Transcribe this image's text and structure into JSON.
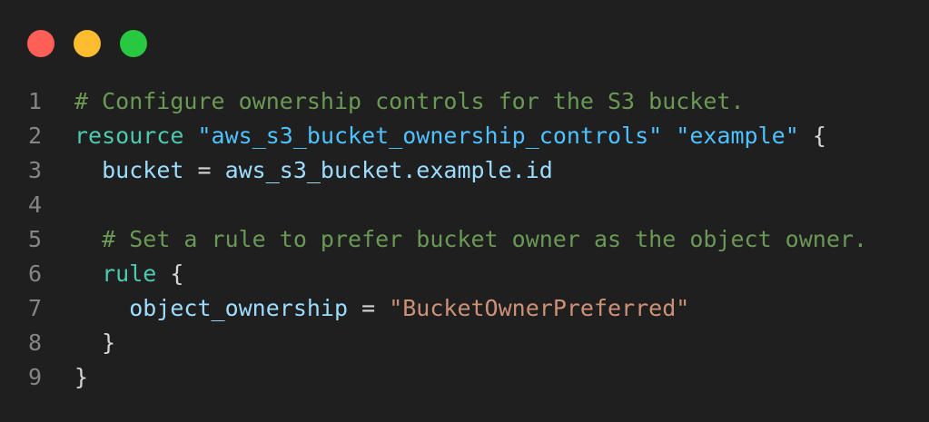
{
  "window": {
    "controls": [
      {
        "name": "close",
        "color": "#ff5f57"
      },
      {
        "name": "minimize",
        "color": "#febc2e"
      },
      {
        "name": "maximize",
        "color": "#28c840"
      }
    ]
  },
  "editor": {
    "language": "HCL",
    "lines": [
      {
        "number": "1",
        "tokens": [
          {
            "type": "comment",
            "text": "# Configure ownership controls for the S3 bucket."
          }
        ]
      },
      {
        "number": "2",
        "tokens": [
          {
            "type": "keyword",
            "text": "resource"
          },
          {
            "type": "punct",
            "text": " "
          },
          {
            "type": "string",
            "text": "\"aws_s3_bucket_ownership_controls\""
          },
          {
            "type": "punct",
            "text": " "
          },
          {
            "type": "string",
            "text": "\"example\""
          },
          {
            "type": "punct",
            "text": " {"
          }
        ]
      },
      {
        "number": "3",
        "tokens": [
          {
            "type": "punct",
            "text": "  "
          },
          {
            "type": "attr",
            "text": "bucket"
          },
          {
            "type": "punct",
            "text": " = "
          },
          {
            "type": "attr",
            "text": "aws_s3_bucket.example.id"
          }
        ]
      },
      {
        "number": "4",
        "tokens": []
      },
      {
        "number": "5",
        "tokens": [
          {
            "type": "punct",
            "text": "  "
          },
          {
            "type": "comment",
            "text": "# Set a rule to prefer bucket owner as the object owner."
          }
        ]
      },
      {
        "number": "6",
        "tokens": [
          {
            "type": "punct",
            "text": "  "
          },
          {
            "type": "keyword",
            "text": "rule"
          },
          {
            "type": "punct",
            "text": " {"
          }
        ]
      },
      {
        "number": "7",
        "tokens": [
          {
            "type": "punct",
            "text": "    "
          },
          {
            "type": "attr",
            "text": "object_ownership"
          },
          {
            "type": "punct",
            "text": " = "
          },
          {
            "type": "value",
            "text": "\"BucketOwnerPreferred\""
          }
        ]
      },
      {
        "number": "8",
        "tokens": [
          {
            "type": "punct",
            "text": "  }"
          }
        ]
      },
      {
        "number": "9",
        "tokens": [
          {
            "type": "punct",
            "text": "}"
          }
        ]
      }
    ]
  }
}
